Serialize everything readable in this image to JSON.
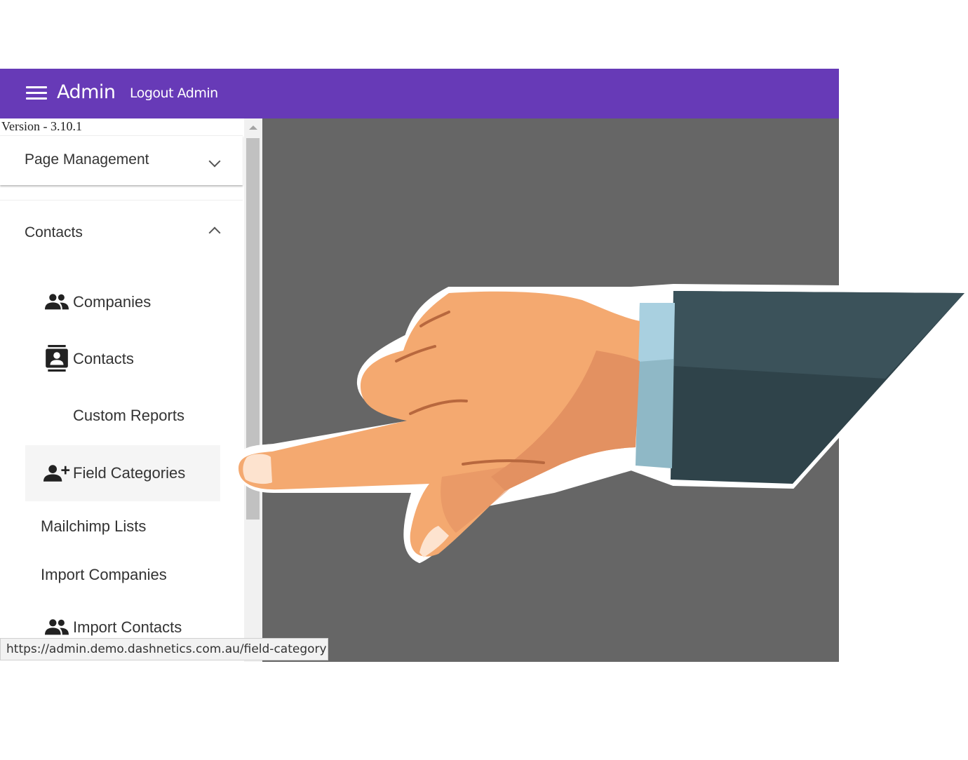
{
  "header": {
    "menu_icon": "hamburger-menu-icon",
    "brand": "Admin",
    "logout_label": "Logout Admin",
    "bg_color": "#673ab7"
  },
  "sidebar": {
    "version": "Version - 3.10.1",
    "panels": [
      {
        "title": "Page Management",
        "expanded": false,
        "icon": "chevron-down-icon"
      },
      {
        "title": "Contacts",
        "expanded": true,
        "icon": "chevron-up-icon"
      }
    ],
    "items": [
      {
        "label": "Companies",
        "icon": "people-icon"
      },
      {
        "label": "Contacts",
        "icon": "contact-card-icon"
      },
      {
        "label": "Custom Reports",
        "icon": ""
      },
      {
        "label": "Field Categories",
        "icon": "person-add-icon",
        "active": true
      },
      {
        "label": "Mailchimp Lists",
        "icon": ""
      },
      {
        "label": "Import Companies",
        "icon": ""
      },
      {
        "label": "Import Contacts",
        "icon": "people-icon"
      }
    ]
  },
  "status_bar": {
    "url": "https://admin.demo.dashnetics.com.au/field-category"
  },
  "overlay": {
    "icon": "pointing-hand-icon"
  }
}
